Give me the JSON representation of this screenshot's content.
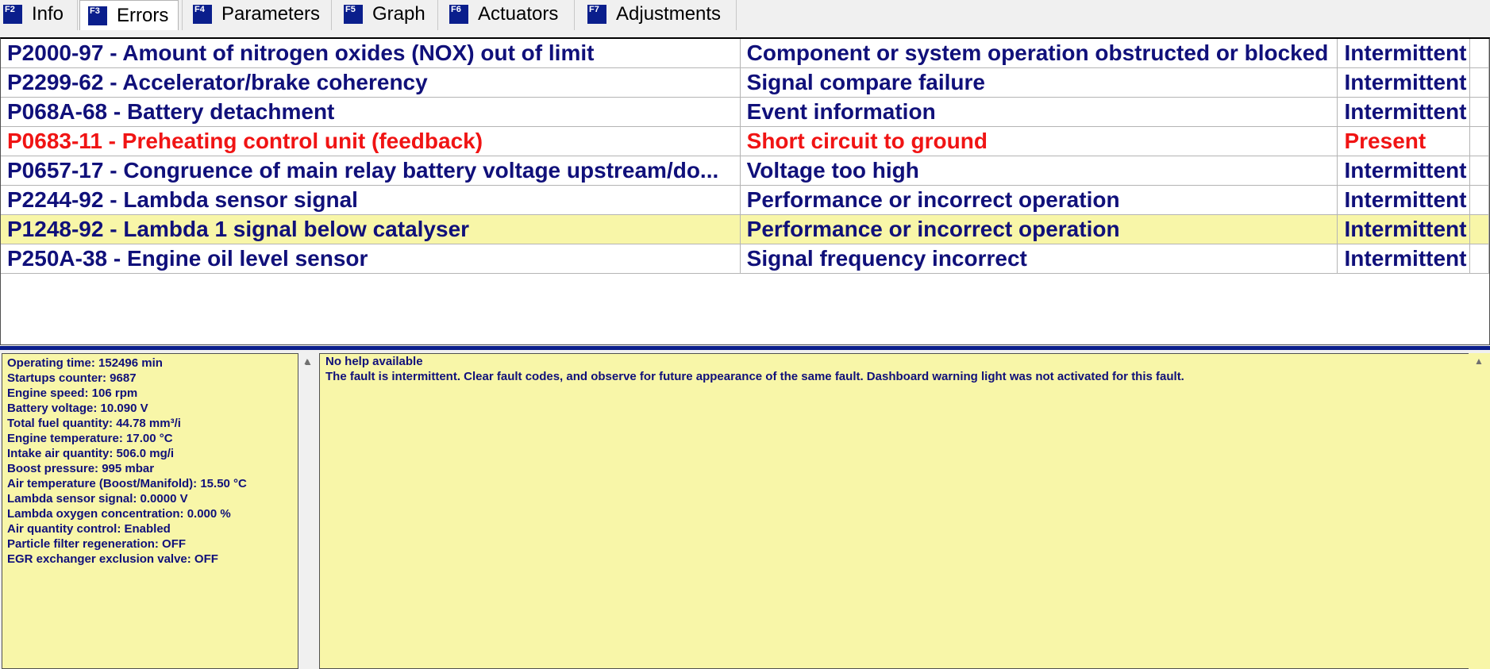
{
  "tabs": [
    {
      "key": "F2",
      "label": "Info"
    },
    {
      "key": "F3",
      "label": "Errors"
    },
    {
      "key": "F4",
      "label": "Parameters"
    },
    {
      "key": "F5",
      "label": "Graph"
    },
    {
      "key": "F6",
      "label": "Actuators"
    },
    {
      "key": "F7",
      "label": "Adjustments"
    }
  ],
  "active_tab": "Errors",
  "faults": [
    {
      "code": "P2000-97 - Amount of nitrogen oxides (NOX) out of limit",
      "description": "Component or system operation obstructed or blocked",
      "status": "Intermittent"
    },
    {
      "code": "P2299-62 - Accelerator/brake coherency",
      "description": "Signal compare failure",
      "status": "Intermittent"
    },
    {
      "code": "P068A-68 - Battery detachment",
      "description": "Event information",
      "status": "Intermittent"
    },
    {
      "code": "P0683-11 - Preheating control unit (feedback)",
      "description": "Short circuit to ground",
      "status": "Present"
    },
    {
      "code": "P0657-17 - Congruence of main relay battery voltage upstream/do...",
      "description": "Voltage too high",
      "status": "Intermittent"
    },
    {
      "code": "P2244-92 - Lambda sensor signal",
      "description": "Performance or incorrect operation",
      "status": "Intermittent"
    },
    {
      "code": "P1248-92 - Lambda 1 signal below catalyser",
      "description": "Performance or incorrect operation",
      "status": "Intermittent"
    },
    {
      "code": "P250A-38 - Engine oil level sensor",
      "description": "Signal frequency incorrect",
      "status": "Intermittent"
    }
  ],
  "selected_fault_index": 6,
  "freeze_frame": [
    "Operating time: 152496 min",
    "Startups counter: 9687",
    "Engine speed: 106 rpm",
    "Battery voltage: 10.090 V",
    "Total fuel quantity: 44.78 mm³/i",
    "Engine temperature: 17.00 °C",
    "Intake air quantity: 506.0 mg/i",
    "Boost pressure: 995 mbar",
    "Air temperature (Boost/Manifold): 15.50 °C",
    "Lambda sensor signal: 0.0000 V",
    "Lambda oxygen concentration: 0.000 %",
    "Air quantity control: Enabled",
    "Particle filter regeneration: OFF",
    "EGR exchanger exclusion valve: OFF"
  ],
  "help": {
    "title": "No help available",
    "text": "The fault is intermittent. Clear fault codes, and observe for future appearance of the same fault. Dashboard warning light was not activated for this fault."
  },
  "colors": {
    "text_blue": "#10107a",
    "present_red": "#f01414",
    "highlight_yellow": "#f8f6a8",
    "fkey_badge": "#0a1e8c"
  },
  "icons": {
    "scroll_up": "▲"
  }
}
